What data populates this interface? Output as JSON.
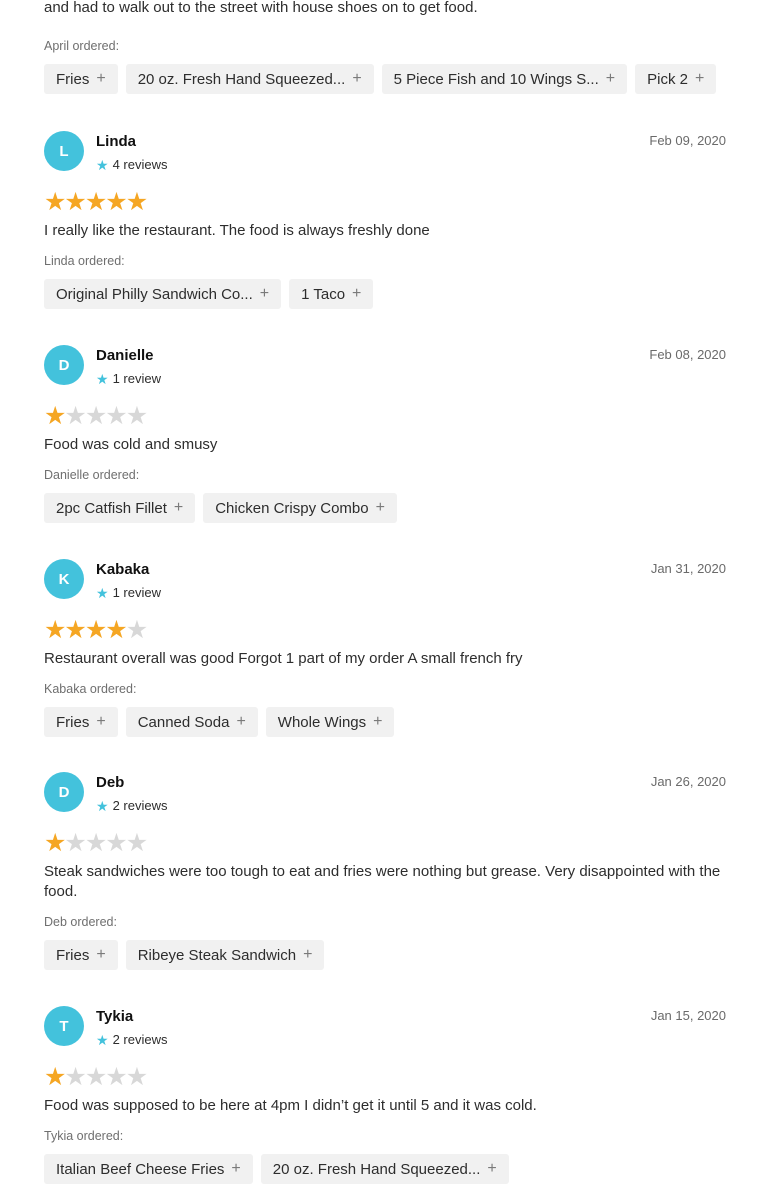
{
  "intro": {
    "text": "The food was pretty good. The only issue was that the driver was late and the driver stayed in the car and had to walk out to the street with house shoes on to get food.",
    "ordered_label": "April ordered:",
    "items": [
      "Fries",
      "20 oz. Fresh Hand Squeezed...",
      "5 Piece Fish and 10 Wings S...",
      "Pick 2"
    ]
  },
  "icons": {
    "add": "plus-icon",
    "review_star": "star-icon",
    "rating_star": "star-icon"
  },
  "colors": {
    "avatar": "#43c2dc",
    "star_filled": "#f5a623",
    "star_empty": "#d8d8d8",
    "chip_bg": "#f1f1f1"
  },
  "reviews": [
    {
      "initial": "L",
      "name": "Linda",
      "count": "4 reviews",
      "date": "Feb 09, 2020",
      "rating": 5,
      "text": "I really like the restaurant. The food is always freshly done",
      "ordered_label": "Linda ordered:",
      "items": [
        "Original Philly Sandwich Co...",
        "1 Taco"
      ]
    },
    {
      "initial": "D",
      "name": "Danielle",
      "count": "1 review",
      "date": "Feb 08, 2020",
      "rating": 1,
      "text": "Food was cold and smusy",
      "ordered_label": "Danielle ordered:",
      "items": [
        "2pc Catfish Fillet",
        "Chicken Crispy Combo"
      ]
    },
    {
      "initial": "K",
      "name": "Kabaka",
      "count": "1 review",
      "date": "Jan 31, 2020",
      "rating": 4,
      "text": "Restaurant overall was good Forgot 1 part of my order A small french fry",
      "ordered_label": "Kabaka ordered:",
      "items": [
        "Fries",
        "Canned Soda",
        "Whole Wings"
      ]
    },
    {
      "initial": "D",
      "name": "Deb",
      "count": "2 reviews",
      "date": "Jan 26, 2020",
      "rating": 1,
      "text": "Steak sandwiches were too tough to eat and fries were nothing but grease. Very disappointed with the food.",
      "ordered_label": "Deb ordered:",
      "items": [
        "Fries",
        "Ribeye Steak Sandwich"
      ]
    },
    {
      "initial": "T",
      "name": "Tykia",
      "count": "2 reviews",
      "date": "Jan 15, 2020",
      "rating": 1,
      "text": "Food was supposed to be here at 4pm I didn’t get it until 5 and it was cold.",
      "ordered_label": "Tykia ordered:",
      "items": [
        "Italian Beef Cheese Fries",
        "20 oz. Fresh Hand Squeezed..."
      ]
    }
  ]
}
